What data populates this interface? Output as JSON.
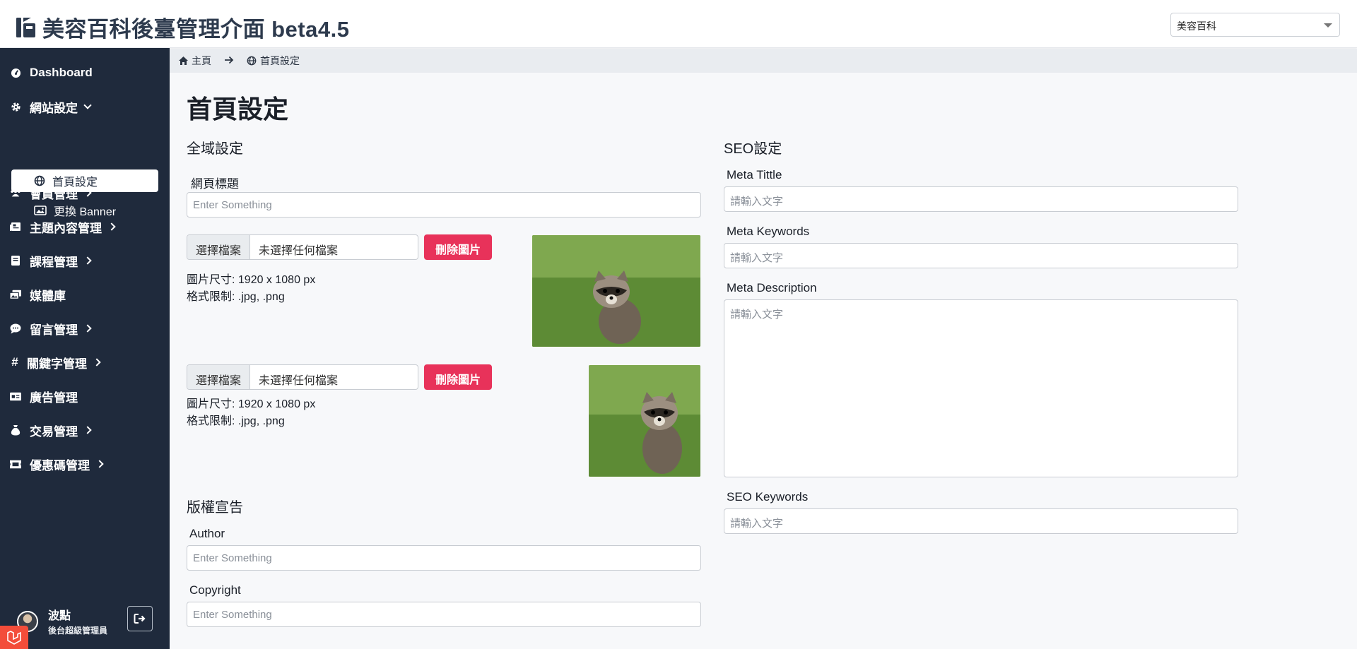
{
  "header": {
    "title": "美容百科後臺管理介面 beta4.5",
    "site_select": "美容百科"
  },
  "sidebar": {
    "items": [
      {
        "label": "Dashboard"
      },
      {
        "label": "網站設定"
      },
      {
        "label": "會員管理"
      },
      {
        "label": "主題內容管理"
      },
      {
        "label": "課程管理"
      },
      {
        "label": "媒體庫"
      },
      {
        "label": "留言管理"
      },
      {
        "label": "關鍵字管理"
      },
      {
        "label": "廣告管理"
      },
      {
        "label": "交易管理"
      },
      {
        "label": "優惠碼管理"
      }
    ],
    "sub_items": [
      {
        "label": "首頁設定"
      },
      {
        "label": "更換 Banner"
      }
    ],
    "user": {
      "name": "波點",
      "role": "後台超級管理員"
    }
  },
  "breadcrumb": {
    "home": "主頁",
    "current": "首頁設定"
  },
  "page": {
    "title": "首頁設定"
  },
  "global": {
    "heading": "全域設定",
    "page_title_label": "網頁標題",
    "page_title_placeholder": "Enter Something",
    "uploads": [
      {
        "button": "選擇檔案",
        "filename": "未選擇任何檔案",
        "delete": "刪除圖片",
        "size": "圖片尺寸: 1920 x 1080 px",
        "format": "格式限制: .jpg, .png"
      },
      {
        "button": "選擇檔案",
        "filename": "未選擇任何檔案",
        "delete": "刪除圖片",
        "size": "圖片尺寸: 1920 x 1080 px",
        "format": "格式限制: .jpg, .png"
      }
    ]
  },
  "copyright": {
    "heading": "版權宣告",
    "author_label": "Author",
    "author_placeholder": "Enter Something",
    "copyright_label": "Copyright",
    "copyright_placeholder": "Enter Something"
  },
  "seo": {
    "heading": "SEO設定",
    "meta_title_label": "Meta Tittle",
    "meta_title_placeholder": "請輸入文字",
    "meta_keywords_label": "Meta Keywords",
    "meta_keywords_placeholder": "請輸入文字",
    "meta_description_label": "Meta Description",
    "meta_description_placeholder": "請輸入文字",
    "seo_keywords_label": "SEO Keywords",
    "seo_keywords_placeholder": "請輸入文字"
  },
  "colors": {
    "sidebar": "#1f2a3c",
    "danger": "#e8325a",
    "title": "#2d3a4d"
  }
}
